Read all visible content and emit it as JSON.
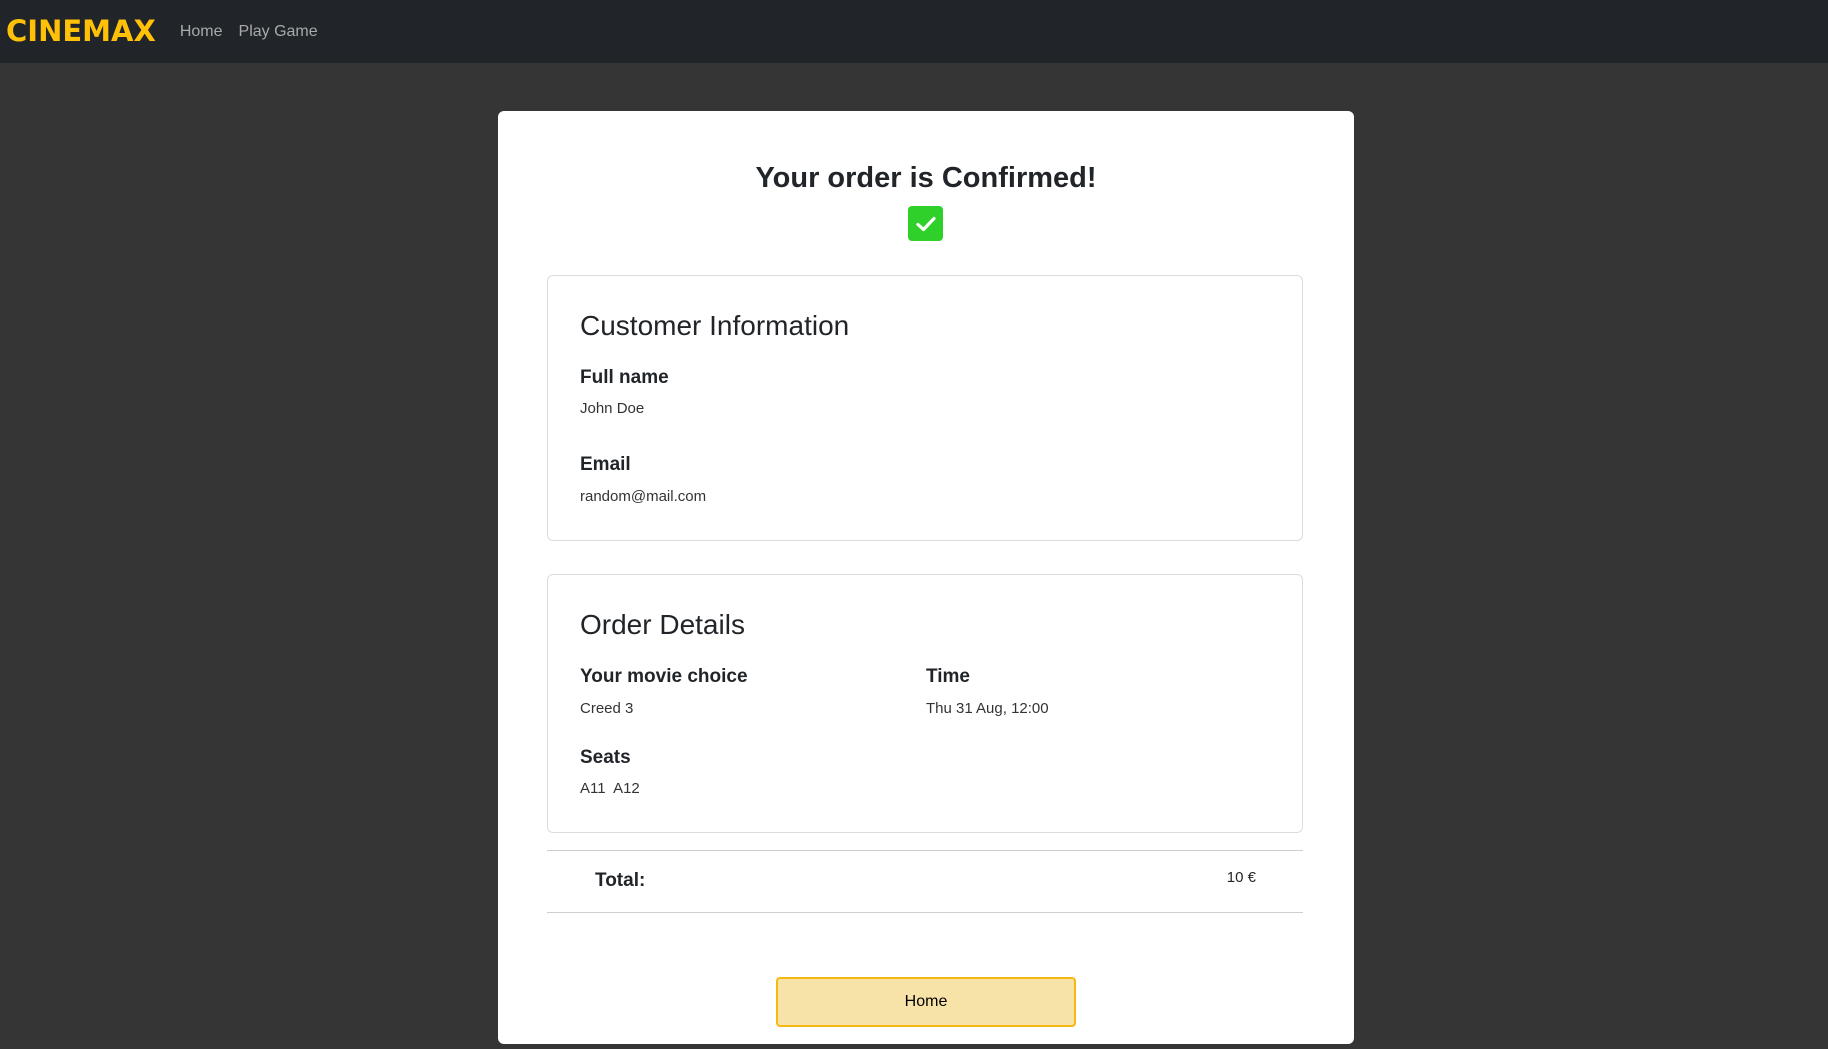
{
  "navbar": {
    "brand": "CINEMAX",
    "links": [
      "Home",
      "Play Game"
    ]
  },
  "confirmation": {
    "title": "Your order is Confirmed!",
    "icon": "check-icon",
    "icon_color": "#2fd02a"
  },
  "customer": {
    "heading": "Customer Information",
    "full_name_label": "Full name",
    "full_name_value": "John Doe",
    "email_label": "Email",
    "email_value": "random@mail.com"
  },
  "order": {
    "heading": "Order Details",
    "movie_label": "Your movie choice",
    "movie_value": "Creed 3",
    "time_label": "Time",
    "time_value": "Thu 31 Aug, 12:00",
    "seats_label": "Seats",
    "seats_value": "A11  A12"
  },
  "total": {
    "label": "Total:",
    "value": "10 €"
  },
  "home_button": {
    "label": "Home"
  },
  "colors": {
    "brand": "#ffc107",
    "navbar_bg": "#212529",
    "page_bg": "#353535",
    "button_bg": "#f7e2a7",
    "button_border": "#f5b914"
  }
}
